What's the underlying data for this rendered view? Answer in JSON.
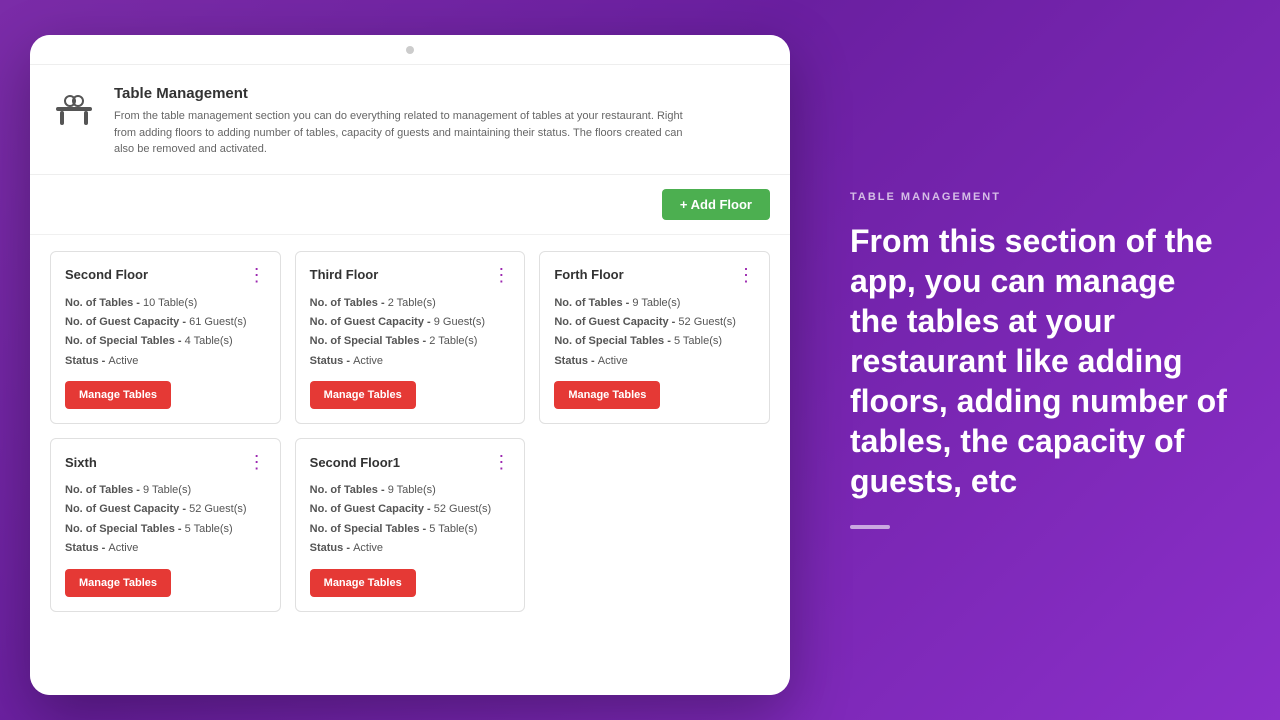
{
  "window": {
    "topbar_dot": "●"
  },
  "header": {
    "title": "Table Management",
    "description": "From the table management section you can do everything related to management of tables at your restaurant. Right from adding floors to adding number of tables, capacity of guests and maintaining their status. The floors created can also be removed and activated."
  },
  "add_floor_button": "+ Add Floor",
  "floors": [
    {
      "name": "Second Floor",
      "tables": "10 Table(s)",
      "guest_capacity": "61 Guest(s)",
      "special_tables": "4 Table(s)",
      "status": "Active",
      "manage_label": "Manage Tables"
    },
    {
      "name": "Third Floor",
      "tables": "2 Table(s)",
      "guest_capacity": "9 Guest(s)",
      "special_tables": "2 Table(s)",
      "status": "Active",
      "manage_label": "Manage Tables"
    },
    {
      "name": "Forth Floor",
      "tables": "9 Table(s)",
      "guest_capacity": "52 Guest(s)",
      "special_tables": "5 Table(s)",
      "status": "Active",
      "manage_label": "Manage Tables"
    },
    {
      "name": "Sixth",
      "tables": "9 Table(s)",
      "guest_capacity": "52 Guest(s)",
      "special_tables": "5 Table(s)",
      "status": "Active",
      "manage_label": "Manage Tables"
    },
    {
      "name": "Second Floor1",
      "tables": "9 Table(s)",
      "guest_capacity": "52 Guest(s)",
      "special_tables": "5 Table(s)",
      "status": "Active",
      "manage_label": "Manage Tables"
    }
  ],
  "floor_labels": {
    "no_of_tables": "No. of Tables - ",
    "guest_capacity": "No. of Guest Capacity - ",
    "special_tables": "No. of Special Tables - ",
    "status": "Status - "
  },
  "right_panel": {
    "section_label": "TABLE MANAGEMENT",
    "main_text": "From this section of the app, you can manage the tables at your restaurant like adding floors, adding number of tables, the capacity of guests, etc"
  }
}
